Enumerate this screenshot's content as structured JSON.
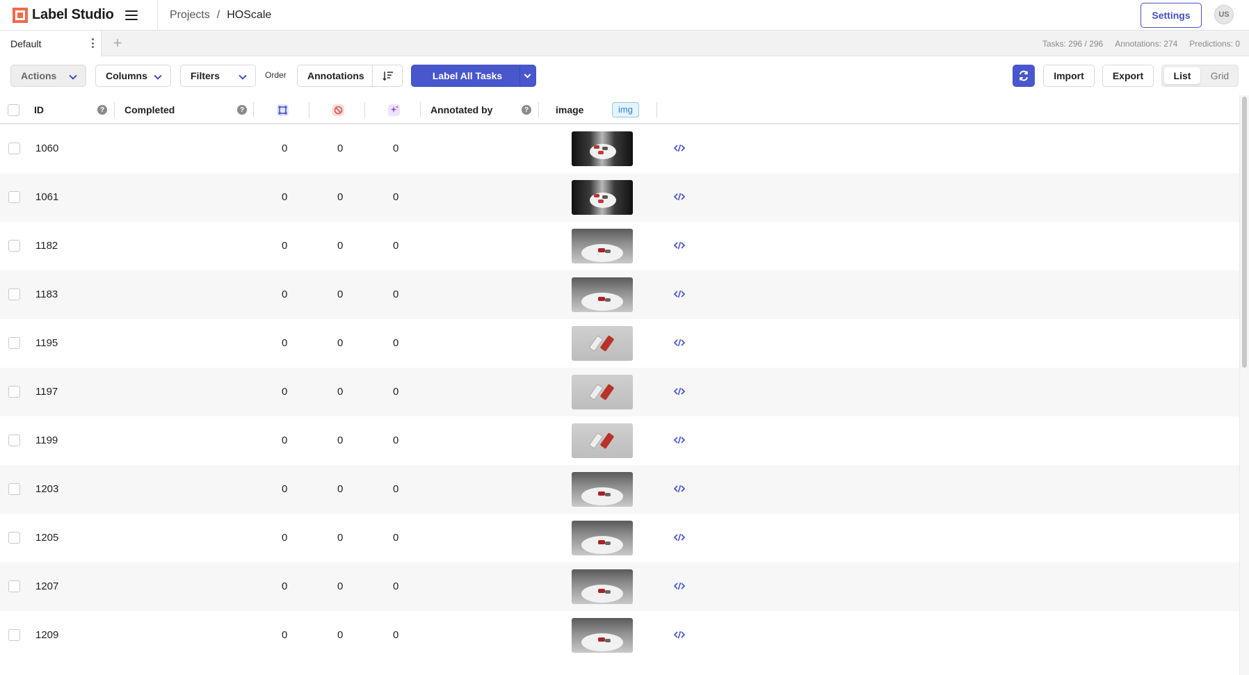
{
  "app": {
    "name": "Label Studio"
  },
  "breadcrumb": {
    "projects": "Projects",
    "separator": "/",
    "current": "HOScale"
  },
  "header": {
    "settings_label": "Settings",
    "avatar_initials": "US"
  },
  "tabs": {
    "active": "Default",
    "add_symbol": "+"
  },
  "stats": {
    "tasks": "Tasks: 296 / 296",
    "annotations": "Annotations: 274",
    "predictions": "Predictions: 0"
  },
  "toolbar": {
    "actions": "Actions",
    "columns": "Columns",
    "filters": "Filters",
    "order": "Order",
    "order_field": "Annotations",
    "label_all": "Label All Tasks",
    "import": "Import",
    "export": "Export",
    "view_list": "List",
    "view_grid": "Grid"
  },
  "columns": {
    "id": "ID",
    "completed": "Completed",
    "annotated_by": "Annotated by",
    "image": "image",
    "image_type": "img",
    "icons": [
      "annotations-count-icon",
      "cancelled-count-icon",
      "predictions-count-icon"
    ]
  },
  "colors": {
    "accent": "#4957cc",
    "brand": "#ee6b4b"
  },
  "rows": [
    {
      "id": "1060",
      "annotations": "0",
      "cancelled": "0",
      "predictions": "0",
      "thumb": "dark"
    },
    {
      "id": "1061",
      "annotations": "0",
      "cancelled": "0",
      "predictions": "0",
      "thumb": "dark"
    },
    {
      "id": "1182",
      "annotations": "0",
      "cancelled": "0",
      "predictions": "0",
      "thumb": "grey"
    },
    {
      "id": "1183",
      "annotations": "0",
      "cancelled": "0",
      "predictions": "0",
      "thumb": "grey"
    },
    {
      "id": "1195",
      "annotations": "0",
      "cancelled": "0",
      "predictions": "0",
      "thumb": "light"
    },
    {
      "id": "1197",
      "annotations": "0",
      "cancelled": "0",
      "predictions": "0",
      "thumb": "light"
    },
    {
      "id": "1199",
      "annotations": "0",
      "cancelled": "0",
      "predictions": "0",
      "thumb": "light"
    },
    {
      "id": "1203",
      "annotations": "0",
      "cancelled": "0",
      "predictions": "0",
      "thumb": "grey"
    },
    {
      "id": "1205",
      "annotations": "0",
      "cancelled": "0",
      "predictions": "0",
      "thumb": "grey"
    },
    {
      "id": "1207",
      "annotations": "0",
      "cancelled": "0",
      "predictions": "0",
      "thumb": "grey"
    },
    {
      "id": "1209",
      "annotations": "0",
      "cancelled": "0",
      "predictions": "0",
      "thumb": "grey"
    }
  ]
}
